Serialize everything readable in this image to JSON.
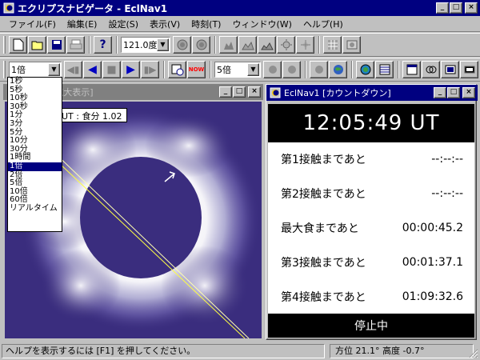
{
  "app": {
    "title": "エクリプスナビゲータ - EclNav1",
    "min_label": "_",
    "max_label": "□",
    "close_label": "×"
  },
  "menu": {
    "items": [
      "ファイル(F)",
      "編集(E)",
      "設定(S)",
      "表示(V)",
      "時刻(T)",
      "ウィンドウ(W)",
      "ヘルプ(H)"
    ]
  },
  "toolbar1": {
    "zoom_value": "121.0度"
  },
  "toolbar2": {
    "speed_value": "1倍",
    "step_value": "5倍",
    "now_label": "NOW"
  },
  "speed_options": {
    "items": [
      "1秒",
      "5秒",
      "10秒",
      "30秒",
      "1分",
      "3分",
      "5分",
      "10分",
      "30分",
      "1時間",
      "1倍",
      "2倍",
      "5倍",
      "10倍",
      "60倍",
      "リアルタイム"
    ],
    "selected": "1倍"
  },
  "eclipse_window": {
    "title": "[拡大表示]",
    "readout": "UT : 食分 1.02"
  },
  "countdown_window": {
    "title": "EclNav1 [カウントダウン]",
    "clock": "12:05:49 UT",
    "rows": [
      {
        "label": "第1接触まであと",
        "value": "--:--:--"
      },
      {
        "label": "第2接触まであと",
        "value": "--:--:--"
      },
      {
        "label": "最大食まであと",
        "value": "00:00:45.2"
      },
      {
        "label": "第3接触まであと",
        "value": "00:01:37.1"
      },
      {
        "label": "第4接触まであと",
        "value": "01:09:32.6"
      }
    ],
    "status": "停止中"
  },
  "statusbar": {
    "help_text": "ヘルプを表示するには [F1] を押してください。",
    "azimuth_text": "方位  21.1°  高度  -0.7°"
  },
  "colors": {
    "titlebar_active": "#000080",
    "eclipse_sky": "#3a2d7e",
    "moon": "#3a2d7e",
    "corona": "#e8e8f8",
    "path_line": "#ffff40"
  }
}
